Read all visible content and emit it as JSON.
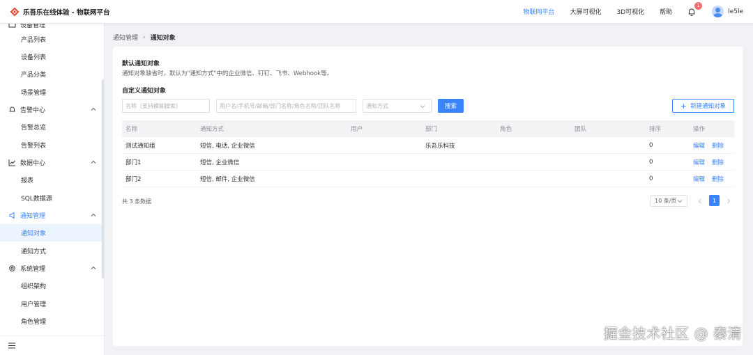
{
  "app": {
    "title": "乐吾乐在线体验 - 物联网平台"
  },
  "top_nav": {
    "items": [
      "物联网平台",
      "大屏可视化",
      "3D可视化",
      "帮助"
    ],
    "notification_count": "1",
    "username": "le5le"
  },
  "sidebar": {
    "partial_top": "设备管理",
    "items": [
      {
        "label": "产品列表"
      },
      {
        "label": "设备列表"
      },
      {
        "label": "产品分类"
      },
      {
        "label": "场景管理"
      },
      {
        "label": "告警中心"
      },
      {
        "label": "告警总览"
      },
      {
        "label": "告警列表"
      },
      {
        "label": "数据中心"
      },
      {
        "label": "报表"
      },
      {
        "label": "SQL数据源"
      },
      {
        "label": "通知管理"
      },
      {
        "label": "通知对象"
      },
      {
        "label": "通知方式"
      },
      {
        "label": "系统管理"
      },
      {
        "label": "组织架构"
      },
      {
        "label": "用户管理"
      },
      {
        "label": "角色管理"
      }
    ]
  },
  "breadcrumb": {
    "parent": "通知管理",
    "current": "通知对象"
  },
  "default_section": {
    "title": "默认通知对象",
    "description": "通知对象缺省时，默认为\"通知方式\"中的企业微信、钉钉、飞书、Webhook等。"
  },
  "custom_section": {
    "title": "自定义通知对象"
  },
  "filters": {
    "name_placeholder": "名称（支持模糊搜索）",
    "contact_placeholder": "用户名/手机号/邮箱/部门名称/角色名称/团队名称",
    "method_placeholder": "通知方式",
    "search_label": "搜索",
    "new_label": "新建通知对象"
  },
  "table": {
    "columns": [
      "名称",
      "通知方式",
      "用户",
      "部门",
      "角色",
      "团队",
      "排序",
      "操作"
    ],
    "rows": [
      {
        "name": "测试通知组",
        "methods": "短信, 电话, 企业微信",
        "user": "",
        "department": "乐吾乐科技",
        "role": "",
        "team": "",
        "order": "0",
        "edit": "编辑",
        "delete": "删除"
      },
      {
        "name": "部门1",
        "methods": "短信, 企业微信",
        "user": "",
        "department": "",
        "role": "",
        "team": "",
        "order": "0",
        "edit": "编辑",
        "delete": "删除"
      },
      {
        "name": "部门2",
        "methods": "短信, 邮件, 企业微信",
        "user": "",
        "department": "",
        "role": "",
        "team": "",
        "order": "0",
        "edit": "编辑",
        "delete": "删除"
      }
    ]
  },
  "pagination": {
    "total_text": "共 3 条数据",
    "page_size": "10 条/页",
    "current_page": "1"
  },
  "watermark": "掘金技术社区 @ 秦清",
  "colors": {
    "accent": "#3a84ff",
    "badge": "#f56c6c",
    "logo": "#e8462b"
  }
}
